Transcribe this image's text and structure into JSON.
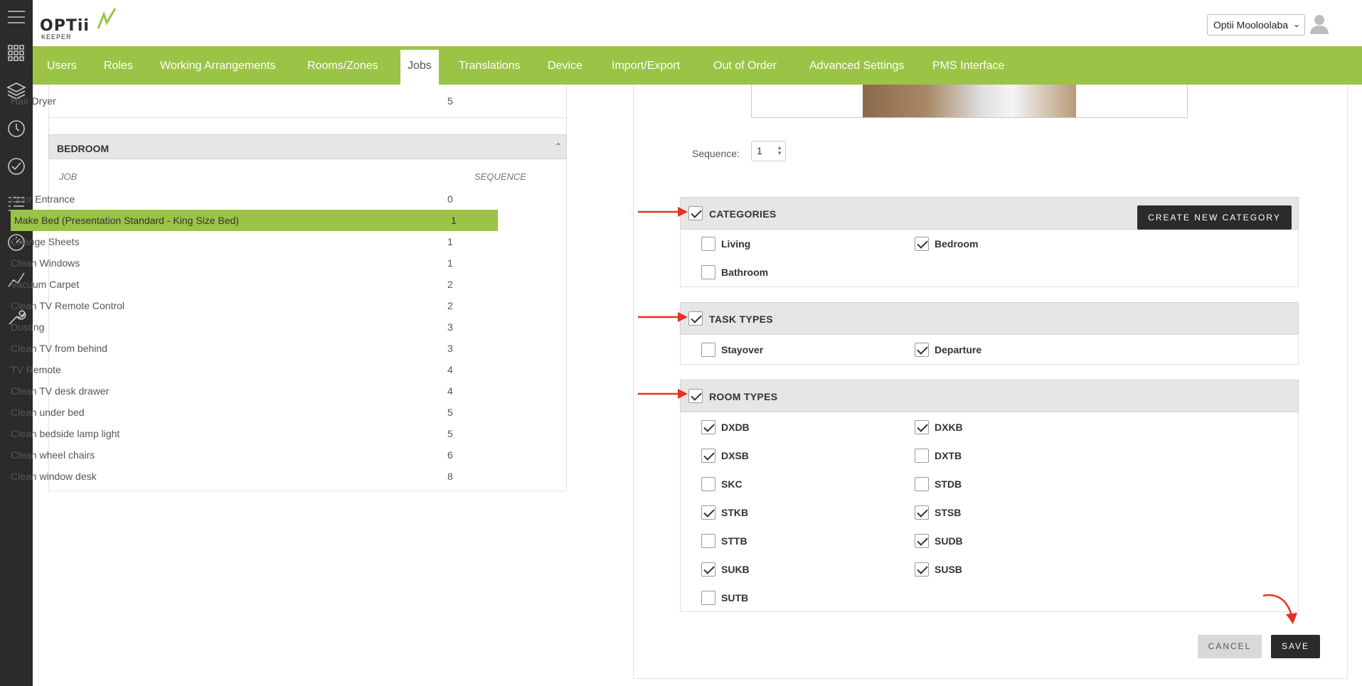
{
  "brand": {
    "name": "OPTii",
    "sub": "KEEPER",
    "accent": "#9bc346",
    "dark": "#2b2b2b"
  },
  "header": {
    "hotel": "Optii Mooloolaba"
  },
  "nav": {
    "items": [
      {
        "label": "Users"
      },
      {
        "label": "Roles"
      },
      {
        "label": "Working Arrangements"
      },
      {
        "label": "Rooms/Zones"
      },
      {
        "label": "Jobs",
        "active": true
      },
      {
        "label": "Translations"
      },
      {
        "label": "Device"
      },
      {
        "label": "Import/Export"
      },
      {
        "label": "Out of Order"
      },
      {
        "label": "Advanced Settings"
      },
      {
        "label": "PMS Interface"
      }
    ]
  },
  "rail": {
    "icons": [
      "menu-icon",
      "grid-icon",
      "layers-icon",
      "clock-icon",
      "check-circle-icon",
      "list-icon",
      "gauge-icon",
      "chart-line-icon",
      "wrench-icon"
    ]
  },
  "left": {
    "prev_row": {
      "job": "Hair Dryer",
      "seq": "5"
    },
    "section": "BEDROOM",
    "col_job": "JOB",
    "col_seq": "SEQUENCE",
    "rows": [
      {
        "job": "Door Entrance",
        "seq": "0"
      },
      {
        "job": "Make Bed (Presentation Standard - King Size Bed)",
        "seq": "1",
        "selected": true
      },
      {
        "job": "Change Sheets",
        "seq": "1"
      },
      {
        "job": "Clean Windows",
        "seq": "1"
      },
      {
        "job": "Vacuum Carpet",
        "seq": "2"
      },
      {
        "job": "Clean TV Remote Control",
        "seq": "2"
      },
      {
        "job": "Dusting",
        "seq": "3"
      },
      {
        "job": "Clean TV from behind",
        "seq": "3"
      },
      {
        "job": "TV Remote",
        "seq": "4"
      },
      {
        "job": "Clean TV desk drawer",
        "seq": "4"
      },
      {
        "job": "Clean under bed",
        "seq": "5"
      },
      {
        "job": "Clean bedside lamp light",
        "seq": "5"
      },
      {
        "job": "Clean wheel chairs",
        "seq": "6"
      },
      {
        "job": "Clean window desk",
        "seq": "8"
      }
    ]
  },
  "form": {
    "sequence_label": "Sequence:",
    "sequence_value": "1",
    "categories": {
      "title": "CATEGORIES",
      "checked": true,
      "create_label": "CREATE NEW CATEGORY",
      "options": [
        {
          "label": "Living",
          "checked": false
        },
        {
          "label": "Bedroom",
          "checked": true
        },
        {
          "label": "Bathroom",
          "checked": false
        }
      ]
    },
    "task_types": {
      "title": "TASK TYPES",
      "checked": true,
      "options": [
        {
          "label": "Stayover",
          "checked": false
        },
        {
          "label": "Departure",
          "checked": true
        }
      ]
    },
    "room_types": {
      "title": "ROOM TYPES",
      "checked": true,
      "options": [
        {
          "label": "DXDB",
          "checked": true
        },
        {
          "label": "DXKB",
          "checked": true
        },
        {
          "label": "DXSB",
          "checked": true
        },
        {
          "label": "DXTB",
          "checked": false
        },
        {
          "label": "SKC",
          "checked": false
        },
        {
          "label": "STDB",
          "checked": false
        },
        {
          "label": "STKB",
          "checked": true
        },
        {
          "label": "STSB",
          "checked": true
        },
        {
          "label": "STTB",
          "checked": false
        },
        {
          "label": "SUDB",
          "checked": true
        },
        {
          "label": "SUKB",
          "checked": true
        },
        {
          "label": "SUSB",
          "checked": true
        },
        {
          "label": "SUTB",
          "checked": false
        }
      ]
    },
    "cancel_label": "CANCEL",
    "save_label": "SAVE"
  }
}
